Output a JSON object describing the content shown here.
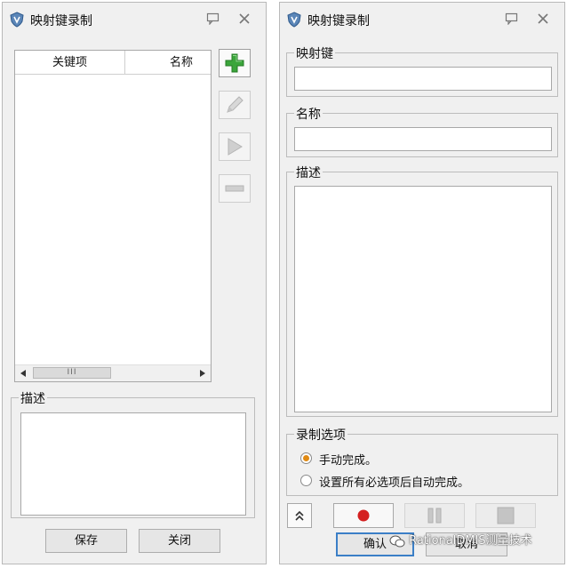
{
  "left_window": {
    "title": "映射键录制",
    "list": {
      "columns": [
        "关键项",
        "名称"
      ],
      "rows": [],
      "scrollbar_thumb": "III"
    },
    "description_label": "描述",
    "save_label": "保存",
    "close_label": "关闭"
  },
  "right_window": {
    "title": "映射键录制",
    "mapping_key_label": "映射键",
    "mapping_key_value": "",
    "name_label": "名称",
    "name_value": "",
    "description_label": "描述",
    "record_options_label": "录制选项",
    "record_options": [
      {
        "label": "手动完成。",
        "checked": true
      },
      {
        "label": "设置所有必选项后自动完成。",
        "checked": false
      }
    ],
    "confirm_label": "确认",
    "cancel_label": "取消"
  },
  "watermark": {
    "text": "RationalDMIS测量技术"
  },
  "icons": {
    "app": "app-shield-icon",
    "pin": "pin-icon",
    "close": "close-icon",
    "add": "plus-icon",
    "edit": "pencil-icon",
    "play": "play-icon",
    "remove": "minus-icon",
    "collapse": "double-chevron-up-icon",
    "record": "record-icon",
    "pause": "pause-icon",
    "stop": "stop-icon"
  },
  "colors": {
    "add_green": "#3aa53a",
    "record_red": "#d42020",
    "radio_orange": "#e08a14",
    "focus_blue": "#3b7fc7"
  }
}
